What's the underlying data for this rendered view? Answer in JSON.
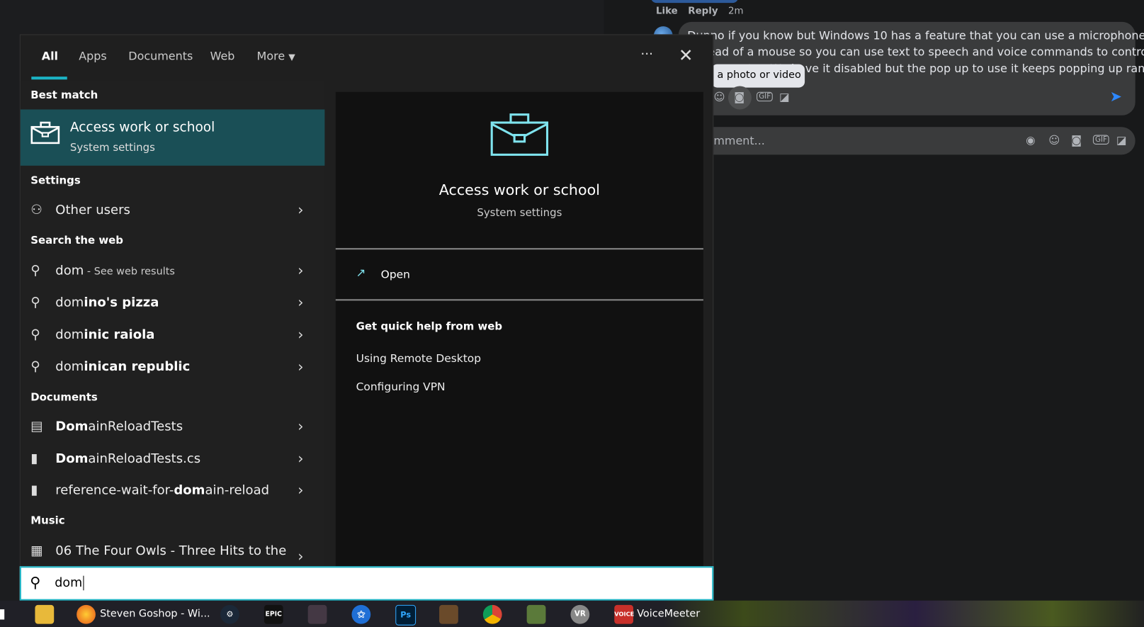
{
  "facebook": {
    "like": "Like",
    "reply": "Reply",
    "time": "2m",
    "comment_lines": [
      "Dunno if you know but Windows 10 has a feature that you can use a microphone",
      "instead of a mouse so you can use text to speech and voice commands to control",
      "the computer. We have it disabled but the pop up to use it keeps popping up ran"
    ],
    "tooltip": "a photo or video",
    "write_placeholder": "mment..."
  },
  "search": {
    "tabs": [
      "All",
      "Apps",
      "Documents",
      "Web",
      "More"
    ],
    "more_icon": "ellipsis-icon",
    "close_icon": "close-icon",
    "best_match_header": "Best match",
    "best_match": {
      "title": "Access work or school",
      "subtitle": "System settings"
    },
    "settings_header": "Settings",
    "settings_items": [
      {
        "label": "Other users"
      }
    ],
    "web_header": "Search the web",
    "web_items": [
      {
        "normal": "dom",
        "bold": "",
        "suffix": " - See web results"
      },
      {
        "normal": "dom",
        "bold": "ino's pizza",
        "suffix": ""
      },
      {
        "normal": "dom",
        "bold": "inic raiola",
        "suffix": ""
      },
      {
        "normal": "dom",
        "bold": "inican republic",
        "suffix": ""
      }
    ],
    "documents_header": "Documents",
    "document_items": [
      {
        "pre": "",
        "bold": "Dom",
        "post": "ainReloadTests"
      },
      {
        "pre": "",
        "bold": "Dom",
        "post": "ainReloadTests.cs"
      },
      {
        "pre": "reference-wait-for-",
        "bold": "dom",
        "post": "ain-reload"
      }
    ],
    "music_header": "Music",
    "music_items": [
      {
        "label": "06 The Four Owls - Three Hits to the"
      }
    ],
    "detail": {
      "title": "Access work or school",
      "subtitle": "System settings",
      "open": "Open",
      "help_header": "Get quick help from web",
      "help_links": [
        "Using Remote Desktop",
        "Configuring VPN"
      ]
    },
    "query": "dom"
  },
  "taskbar": {
    "firefox_label": "Steven Goshop - Wi...",
    "voicemeeter_label": "VoiceMeeter",
    "epic_label": "EPIC",
    "ps_label": "Ps",
    "vr_label": "VR",
    "voice_label": "VOICE"
  },
  "colors": {
    "accent": "#1bb3c4",
    "highlight": "#1a4f56",
    "briefcase": "#7fe3ee"
  }
}
